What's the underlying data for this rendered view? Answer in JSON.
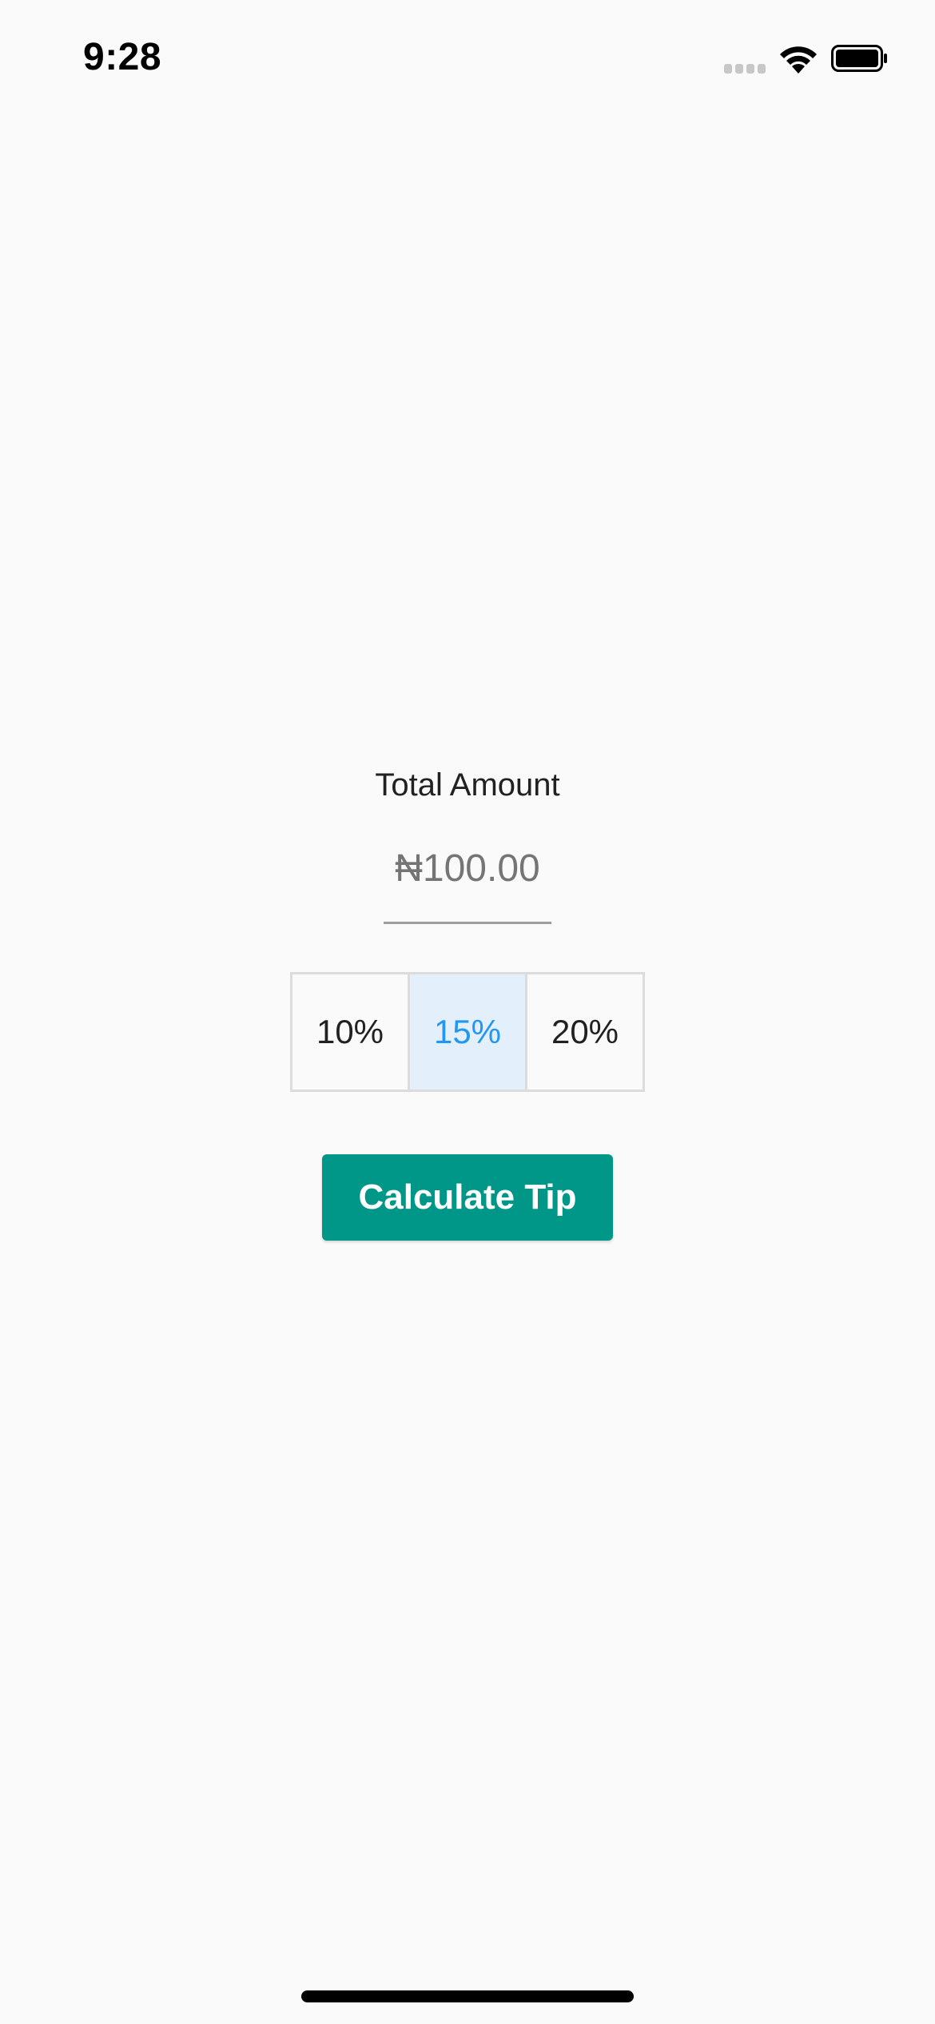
{
  "status_bar": {
    "time": "9:28",
    "icons": [
      "cellular-signal-icon",
      "wifi-icon",
      "battery-icon"
    ]
  },
  "form": {
    "label": "Total Amount",
    "amount_placeholder": "₦100.00",
    "amount_value": ""
  },
  "tip_options": [
    {
      "label": "10%",
      "selected": false
    },
    {
      "label": "15%",
      "selected": true
    },
    {
      "label": "20%",
      "selected": false
    }
  ],
  "actions": {
    "calculate_label": "Calculate Tip"
  },
  "colors": {
    "background": "#fafafa",
    "primary_button": "#009688",
    "selected_text": "#2196f3",
    "selected_background": "#e3f0fb",
    "border": "#dcdcdc"
  }
}
